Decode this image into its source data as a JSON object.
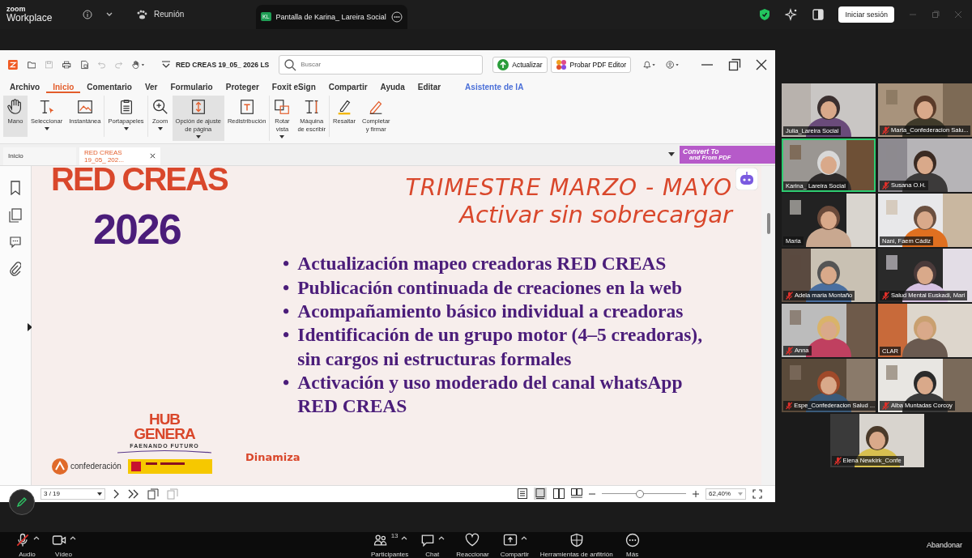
{
  "zoom_bar": {
    "brand_top": "zoom",
    "brand": "Workplace",
    "meeting": "Reunión",
    "share_tab": {
      "initials": "KL",
      "title": "Pantalla de Karina_ Lareira Social"
    },
    "sign_in": "Iniciar sesión"
  },
  "pdf": {
    "doc_title": "RED CREAS 19_05_ 2026 LS",
    "search": {
      "placeholder": "Buscar"
    },
    "update": "Actualizar",
    "try_editor": "Probar PDF Editor",
    "menu": [
      {
        "label": "Archivo",
        "selected": false,
        "kind": "menu"
      },
      {
        "label": "Inicio",
        "selected": true,
        "kind": "menu"
      },
      {
        "label": "Comentario",
        "selected": false,
        "kind": "menu"
      },
      {
        "label": "Ver",
        "selected": false,
        "kind": "menu"
      },
      {
        "label": "Formulario",
        "selected": false,
        "kind": "menu"
      },
      {
        "label": "Proteger",
        "selected": false,
        "kind": "menu"
      },
      {
        "label": "Foxit eSign",
        "selected": false,
        "kind": "menu"
      },
      {
        "label": "Compartir",
        "selected": false,
        "kind": "menu"
      },
      {
        "label": "Ayuda",
        "selected": false,
        "kind": "menu"
      },
      {
        "label": "Editar",
        "selected": false,
        "kind": "menu"
      },
      {
        "label": "Asistente de IA",
        "selected": false,
        "kind": "ai"
      }
    ],
    "tools": [
      {
        "label": "Mano",
        "selected": true,
        "dropdown": false
      },
      {
        "label": "Seleccionar",
        "selected": false,
        "dropdown": true
      },
      {
        "label": "Instantánea",
        "selected": false,
        "dropdown": false
      },
      {
        "label": "Portapapeles",
        "selected": false,
        "dropdown": true
      },
      {
        "label": "Zoom",
        "selected": false,
        "dropdown": true
      },
      {
        "label": "Opción de ajuste\nde página",
        "selected": true,
        "dropdown": true
      },
      {
        "label": "Redistribución",
        "selected": false,
        "dropdown": false
      },
      {
        "label": "Rotar\nvista",
        "selected": false,
        "dropdown": true
      },
      {
        "label": "Máquina\nde escribir",
        "selected": false,
        "dropdown": false
      },
      {
        "label": "Resaltar",
        "selected": false,
        "dropdown": false
      },
      {
        "label": "Completar\ny firmar",
        "selected": false,
        "dropdown": false
      }
    ],
    "doc_tabs": [
      {
        "label": "Inicio",
        "selected": false,
        "closable": false
      },
      {
        "label": "RED CREAS 19_05_ 202...",
        "selected": true,
        "closable": true
      }
    ],
    "banner": {
      "line1": "Convert To",
      "line2": "and From PDF"
    },
    "slide": {
      "title_top": "RED CREAS",
      "year": "2026",
      "heading": "TRIMESTRE MARZO - MAYO",
      "subheading": "Activar sin sobrecargar",
      "bullets": [
        {
          "marker": "•",
          "text": "Actualización mapeo creadoras RED CREAS"
        },
        {
          "marker": "•",
          "text": "Publicación continuada de creaciones en la web"
        },
        {
          "marker": "•",
          "text": "Acompañamiento básico individual a creadoras"
        },
        {
          "marker": "•",
          "text": "Identificación de un grupo motor (4–5 creadoras), sin cargos ni estructuras formales"
        },
        {
          "marker": "•",
          "text": "Activación y uso moderado del canal whatsApp RED CREAS"
        }
      ],
      "hub_line1": "HUB",
      "hub_line2": "GENERA",
      "hub_tagline": "FAENANDO FUTURO",
      "dinamiza": "Dinamiza",
      "partner": "confederación"
    },
    "status": {
      "page": "3 / 19",
      "zoom": "62,40%",
      "zoom_slider": {
        "level": 0.45
      }
    }
  },
  "participants": [
    {
      "name": "Julia_Lareira Social",
      "muted": false,
      "speaking": false
    },
    {
      "name": "Marta_Confederacion Salu...",
      "muted": true,
      "speaking": false
    },
    {
      "name": "Karina_ Lareira Social",
      "muted": false,
      "speaking": true
    },
    {
      "name": "Susana O.H.",
      "muted": true,
      "speaking": false
    },
    {
      "name": "Maria",
      "muted": false,
      "speaking": false
    },
    {
      "name": "Nani, Faem Cádiz",
      "muted": false,
      "speaking": false
    },
    {
      "name": "Adela maria Montaño",
      "muted": true,
      "speaking": false
    },
    {
      "name": "Salud Mental Euskadi, Mari",
      "muted": true,
      "speaking": false
    },
    {
      "name": "Anna",
      "muted": true,
      "speaking": false
    },
    {
      "name": "CLAR",
      "muted": false,
      "speaking": false
    },
    {
      "name": "Espe_Confederacion Salud ...",
      "muted": true,
      "speaking": false
    },
    {
      "name": "Alba Muntadas Corcoy",
      "muted": true,
      "speaking": false
    },
    {
      "name": "Elena Newkirk_Confe",
      "muted": true,
      "speaking": false
    }
  ],
  "controls": [
    {
      "label": "Audio",
      "kind": "audio",
      "muted": true,
      "menu": true
    },
    {
      "label": "Vídeo",
      "kind": "video",
      "muted": false,
      "menu": true
    },
    {
      "label": "Participantes",
      "kind": "participants",
      "count": "13",
      "menu": true
    },
    {
      "label": "Chat",
      "kind": "chat",
      "menu": true
    },
    {
      "label": "Reaccionar",
      "kind": "react",
      "menu": false
    },
    {
      "label": "Compartir",
      "kind": "share",
      "menu": true
    },
    {
      "label": "Herramientas de anfitrión",
      "kind": "host",
      "menu": false
    },
    {
      "label": "Más",
      "kind": "more",
      "menu": false
    }
  ],
  "leave": "Abandonar"
}
